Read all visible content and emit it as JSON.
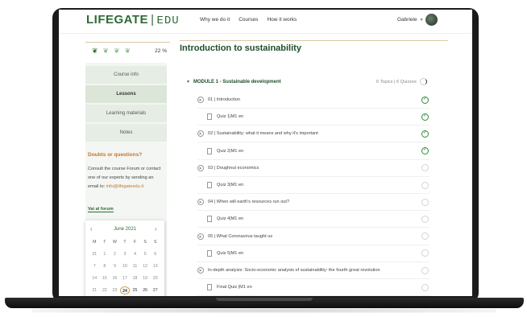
{
  "header": {
    "logo_main": "LIFEGATE",
    "logo_sep": "|",
    "logo_edu": "EDU",
    "nav": [
      "Why we do it",
      "Courses",
      "How it works"
    ],
    "user_name": "Gabriele"
  },
  "sidebar": {
    "progress_percent_label": "22 %",
    "menu": [
      "Course info",
      "Lessons",
      "Learning materials",
      "Notes"
    ],
    "active_menu": "Lessons",
    "doubts_title": "Doubts or questions?",
    "doubts_text": "Consult the course Forum or contact one of our experts by sending an email to: ",
    "doubts_email": "info@lifegateedu.it",
    "forum_link": "Vai al forum"
  },
  "calendar": {
    "month_label": "June 2021",
    "weekdays": [
      "M",
      "T",
      "W",
      "T",
      "F",
      "S",
      "S"
    ],
    "rows": [
      [
        "31",
        "1",
        "2",
        "3",
        "4",
        "5",
        "6"
      ],
      [
        "7",
        "8",
        "9",
        "10",
        "11",
        "12",
        "13"
      ],
      [
        "14",
        "15",
        "16",
        "17",
        "18",
        "19",
        "20"
      ],
      [
        "21",
        "22",
        "23",
        "24",
        "25",
        "26",
        "27"
      ]
    ],
    "today": "24"
  },
  "main": {
    "title": "Introduction to sustainability",
    "module_title": "MODULE 1 - Sustainable development",
    "module_meta": "6 Topics  |  6 Quizzes",
    "items": [
      {
        "kind": "topic",
        "label": "01 | Introduction",
        "done": true
      },
      {
        "kind": "quiz",
        "label": "Quiz 1|M1 en",
        "done": true
      },
      {
        "kind": "topic",
        "label": "02 | Sustainability: what it means and why it's important",
        "done": true
      },
      {
        "kind": "quiz",
        "label": "Quiz 2|M1 en",
        "done": true
      },
      {
        "kind": "topic",
        "label": "03 | Doughnut economics",
        "done": false
      },
      {
        "kind": "quiz",
        "label": "Quiz 3|M1 en",
        "done": false
      },
      {
        "kind": "topic",
        "label": "04 | When will earth's resources run out?",
        "done": false
      },
      {
        "kind": "quiz",
        "label": "Quiz 4|M1 en",
        "done": false
      },
      {
        "kind": "topic",
        "label": "05 | What Coronavirus taught us",
        "done": false
      },
      {
        "kind": "quiz",
        "label": "Quiz 5|M1 en",
        "done": false
      },
      {
        "kind": "topic",
        "label": "In-depth analysis: Socio-economic analysis of sustainability: the fourth great revolution",
        "done": false
      },
      {
        "kind": "quiz",
        "label": "Final Quiz |M1 en",
        "done": false
      }
    ]
  }
}
